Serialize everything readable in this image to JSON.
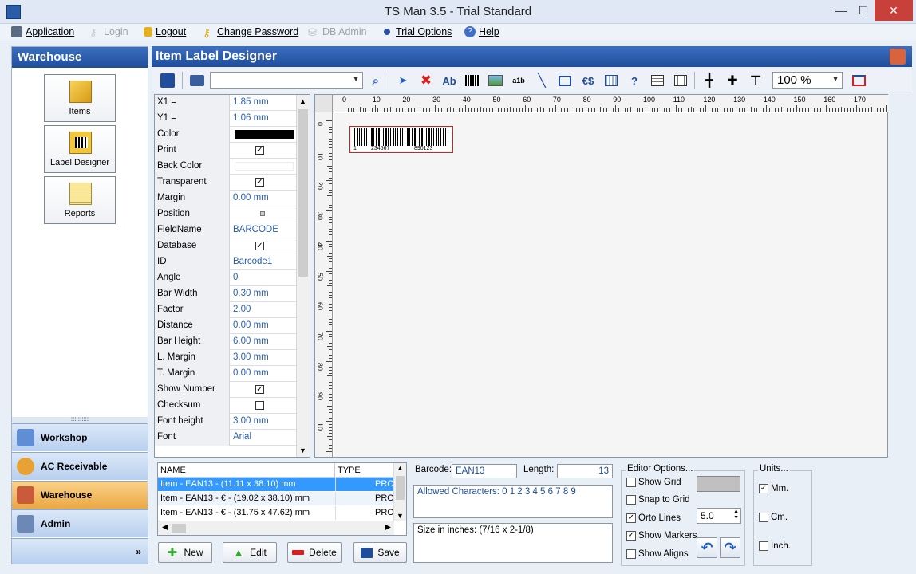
{
  "window": {
    "title": "TS Man 3.5 - Trial Standard",
    "minimize": "—",
    "maximize": "☐",
    "close": "✕"
  },
  "menu": [
    {
      "label": "Application",
      "icon": "application-icon",
      "disabled": false
    },
    {
      "label": "Login",
      "icon": "key-icon",
      "disabled": true
    },
    {
      "label": "Logout",
      "icon": "lock-icon",
      "disabled": false
    },
    {
      "label": "Change Password",
      "icon": "key-icon",
      "disabled": false
    },
    {
      "label": "DB Admin",
      "icon": "db-admin-icon",
      "disabled": true
    },
    {
      "label": "Trial Options",
      "icon": "dot-icon",
      "disabled": false
    },
    {
      "label": "Help",
      "icon": "help-icon",
      "disabled": false
    }
  ],
  "left": {
    "title": "Warehouse",
    "buttons": [
      "Items",
      "Label Designer",
      "Reports"
    ],
    "nav": [
      "Workshop",
      "AC Receivable",
      "Warehouse",
      "Admin"
    ],
    "more": "»"
  },
  "main": {
    "title": "Item Label Designer",
    "zoom": "100 %"
  },
  "props": [
    {
      "name": "X1 =",
      "value": "1.85 mm"
    },
    {
      "name": "Y1 =",
      "value": "1.06 mm"
    },
    {
      "name": "Color",
      "value": ""
    },
    {
      "name": "Print",
      "value": "✓"
    },
    {
      "name": "Back Color",
      "value": ""
    },
    {
      "name": "Transparent",
      "value": "✓"
    },
    {
      "name": "Margin",
      "value": "0.00 mm"
    },
    {
      "name": "Position",
      "value": ""
    },
    {
      "name": "FieldName",
      "value": "BARCODE"
    },
    {
      "name": "Database",
      "value": "✓"
    },
    {
      "name": "ID",
      "value": "Barcode1"
    },
    {
      "name": "Angle",
      "value": "0"
    },
    {
      "name": "Bar Width",
      "value": "0.30 mm"
    },
    {
      "name": "Factor",
      "value": "2.00"
    },
    {
      "name": "Distance",
      "value": "0.00 mm"
    },
    {
      "name": "Bar Height",
      "value": "6.00 mm"
    },
    {
      "name": "L. Margin",
      "value": "3.00 mm"
    },
    {
      "name": "T. Margin",
      "value": "0.00 mm"
    },
    {
      "name": "Show Number",
      "value": "✓"
    },
    {
      "name": "Checksum",
      "value": ""
    },
    {
      "name": "Font height",
      "value": "3.00 mm"
    },
    {
      "name": "Font",
      "value": "Arial"
    }
  ],
  "ruler": {
    "h": [
      "0",
      "10",
      "20",
      "30",
      "40",
      "50",
      "60",
      "70",
      "80",
      "90",
      "100",
      "110",
      "120",
      "130",
      "140",
      "150",
      "160",
      "170"
    ],
    "v": [
      "0",
      "10",
      "20",
      "30",
      "40",
      "50",
      "60",
      "70",
      "80",
      "90",
      "10"
    ]
  },
  "barcode_label": {
    "left": "1",
    "mid": "234567",
    "right": "890123"
  },
  "list": {
    "headers": [
      "NAME",
      "TYPE"
    ],
    "rows": [
      {
        "name": "Item - EAN13 -  (11.11 x 38.10) mm",
        "type": "PRO"
      },
      {
        "name": "Item - EAN13 - € - (19.02 x 38.10) mm",
        "type": "PRO"
      },
      {
        "name": "Item - EAN13 - € - (31.75 x 47.62) mm",
        "type": "PRO"
      }
    ]
  },
  "actions": [
    "New",
    "Edit",
    "Delete",
    "Save"
  ],
  "barcode_info": {
    "barcode_label": "Barcode:",
    "barcode_value": "EAN13",
    "length_label": "Length:",
    "length_value": "13",
    "allowed": "Allowed Characters: 0 1 2 3 4 5 6 7 8 9",
    "size": "Size in inches: (7/16 x 2-1/8)"
  },
  "editor": {
    "title": "Editor Options...",
    "show_grid": "Show Grid",
    "snap_grid": "Snap to Grid",
    "orto": "Orto Lines",
    "markers": "Show Markers",
    "aligns": "Show Aligns",
    "step": "5.0"
  },
  "units": {
    "title": "Units...",
    "mm": "Mm.",
    "cm": "Cm.",
    "inch": "Inch."
  },
  "colors": {
    "accent": "#1f4d9c",
    "active_nav": "#eba843",
    "selection": "#3399ff",
    "value_text": "#2a5fb0"
  }
}
